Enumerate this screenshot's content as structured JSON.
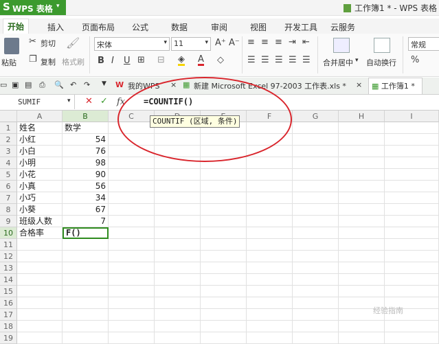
{
  "app": {
    "logo": "S",
    "name": "WPS 表格",
    "doc_title": "工作簿1 * - WPS 表格"
  },
  "menu": [
    "开始",
    "插入",
    "页面布局",
    "公式",
    "数据",
    "审阅",
    "视图",
    "开发工具",
    "云服务"
  ],
  "ribbon": {
    "paste": "粘贴",
    "cut": "剪切",
    "copy": "复制",
    "format_painter": "格式刷",
    "font": "宋体",
    "font_size": "11",
    "merge": "合并居中",
    "wrap": "自动换行",
    "number_format": "常规"
  },
  "doc_tabs": [
    {
      "label": "我的WPS"
    },
    {
      "label": "新建 Microsoft Excel 97-2003 工作表.xls *"
    },
    {
      "label": "工作簿1 *"
    }
  ],
  "formula_bar": {
    "name_box": "SUMIF",
    "fx": "fx",
    "formula": "=COUNTIF()"
  },
  "tooltip": "COUNTIF (区域, 条件)",
  "columns": [
    "A",
    "B",
    "C",
    "D",
    "E",
    "F",
    "G",
    "H",
    "I"
  ],
  "rows": [
    "1",
    "2",
    "3",
    "4",
    "5",
    "6",
    "7",
    "8",
    "9",
    "10",
    "11",
    "12",
    "13",
    "14",
    "15",
    "16",
    "17",
    "18",
    "19"
  ],
  "cells": {
    "A": [
      "姓名",
      "小红",
      "小白",
      "小明",
      "小花",
      "小真",
      "小巧",
      "小葵",
      "班级人数",
      "合格率"
    ],
    "B": [
      "数学",
      "54",
      "76",
      "98",
      "90",
      "56",
      "34",
      "67",
      "7",
      "F()"
    ]
  },
  "watermark": "经验指南",
  "colors": {
    "brand": "#3c9a2e",
    "highlight_circle": "#d9252c"
  }
}
